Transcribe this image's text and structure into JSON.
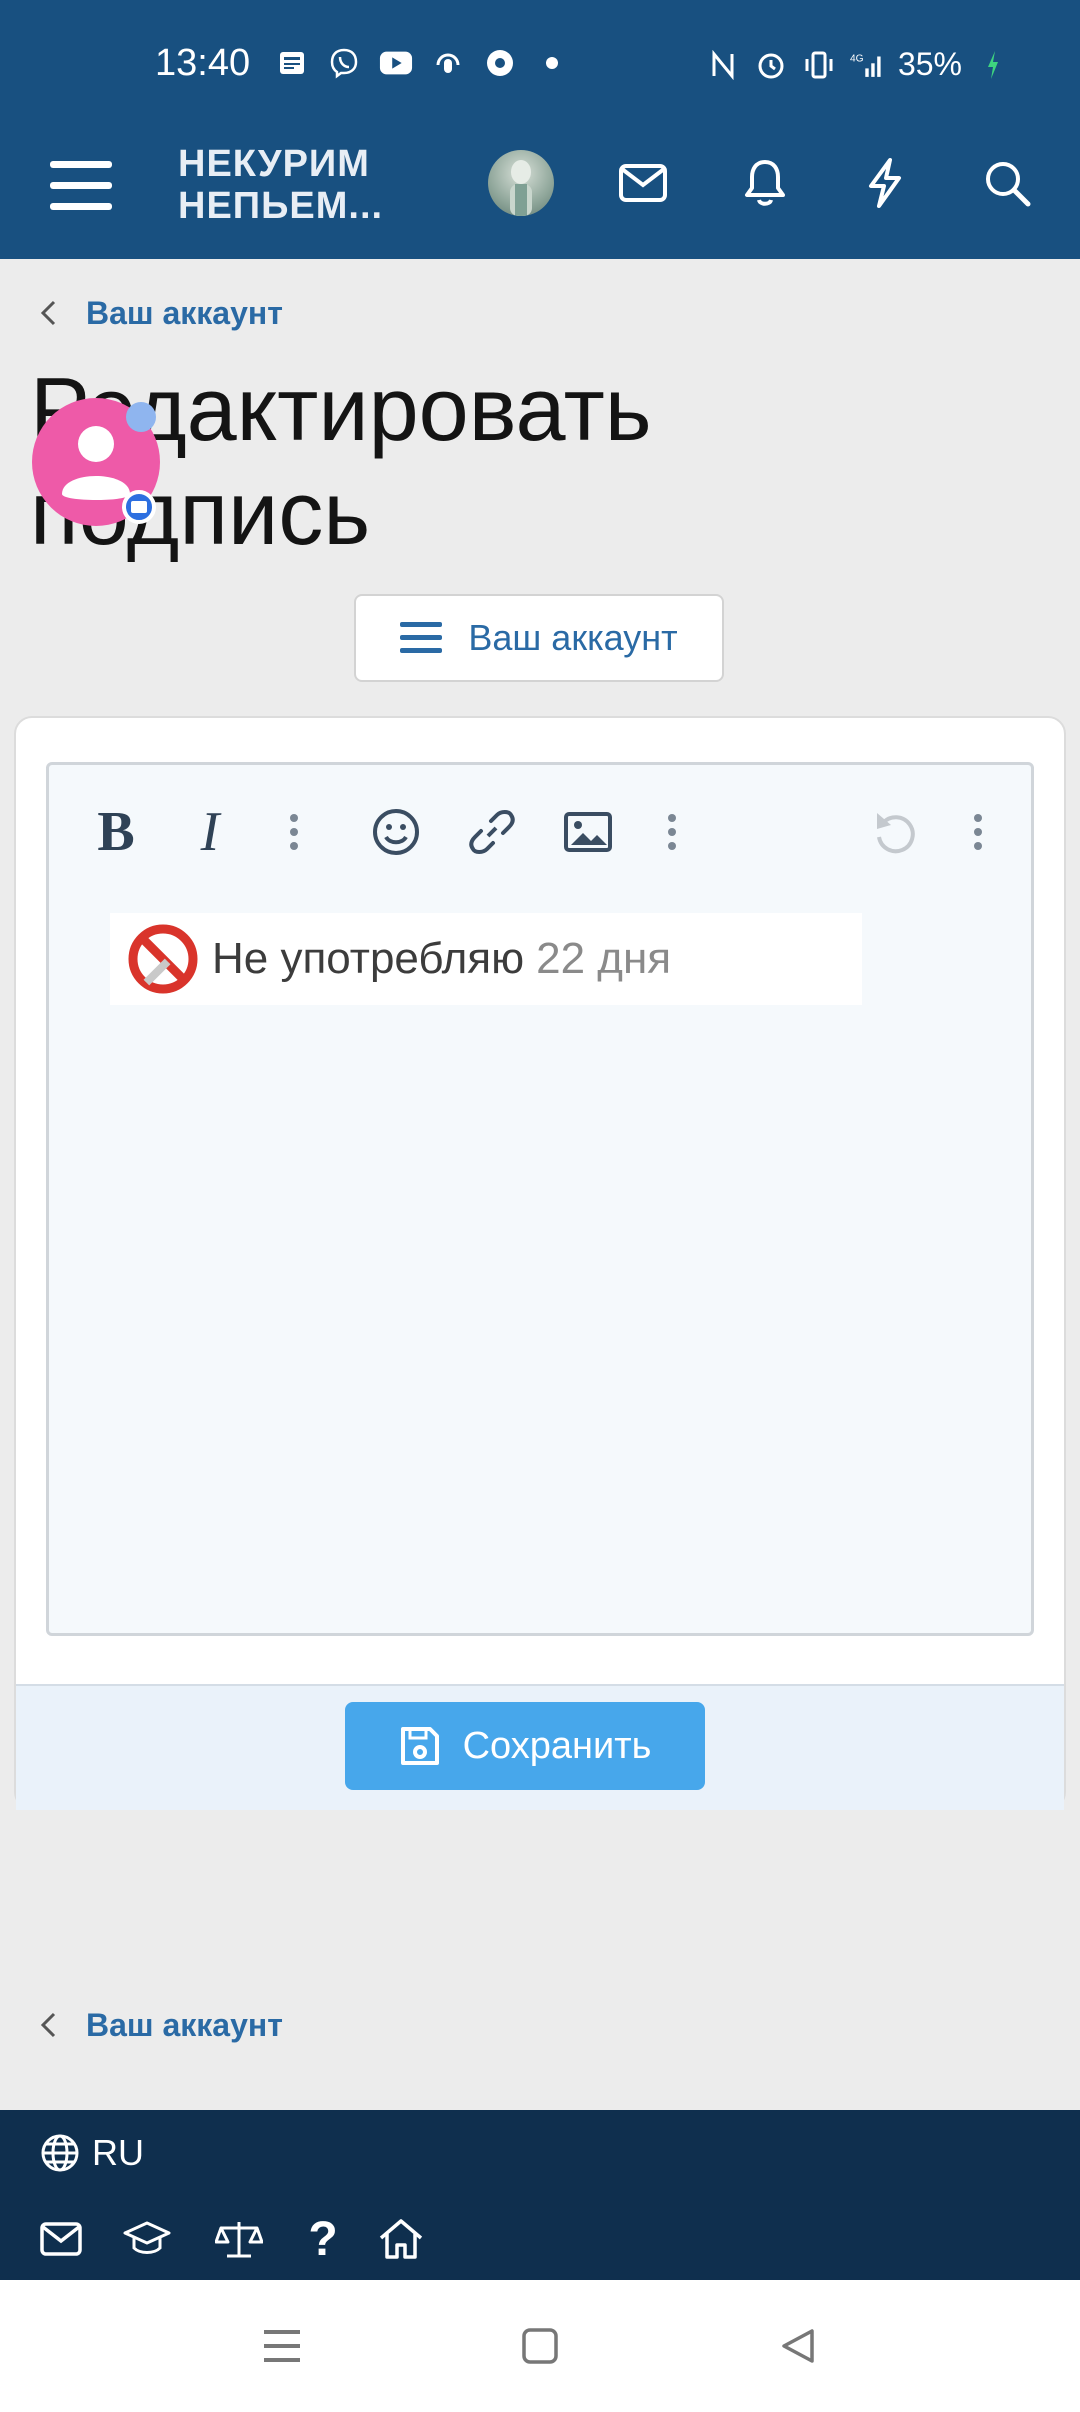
{
  "status_bar": {
    "time": "13:40",
    "battery": "35%",
    "network": "4G",
    "left_icons": [
      "news-icon",
      "viber-icon",
      "youtube-icon",
      "podcast-icon",
      "chrome-icon",
      "dot-icon"
    ],
    "right_icons": [
      "nfc-icon",
      "alarm-icon",
      "vibrate-icon",
      "signal-icon",
      "charging-icon"
    ]
  },
  "header": {
    "logo_line1": "НЕКУРИМ",
    "logo_line2": "НЕПЬЕМ...",
    "colors": {
      "bg": "#185080",
      "accent": "#2a6aa5"
    }
  },
  "breadcrumb": {
    "label": "Ваш аккаунт"
  },
  "page": {
    "title": "Редактировать подпись"
  },
  "account_menu_button": {
    "label": "Ваш аккаунт"
  },
  "editor": {
    "toolbar": [
      "bold",
      "italic",
      "more",
      "smile",
      "link",
      "image",
      "more",
      "undo",
      "more"
    ],
    "bold_label": "B",
    "italic_label": "I",
    "signature": {
      "text": "Не употребляю",
      "days": "22 дня"
    }
  },
  "save_button": {
    "label": "Сохранить",
    "color": "#47a7eb"
  },
  "bottom_breadcrumb": {
    "label": "Ваш аккаунт"
  },
  "footer": {
    "language": "RU",
    "icons": [
      "mail-icon",
      "education-icon",
      "scales-icon",
      "question-icon",
      "home-icon"
    ]
  },
  "system_nav": [
    "recents-icon",
    "home-square-icon",
    "back-icon"
  ]
}
